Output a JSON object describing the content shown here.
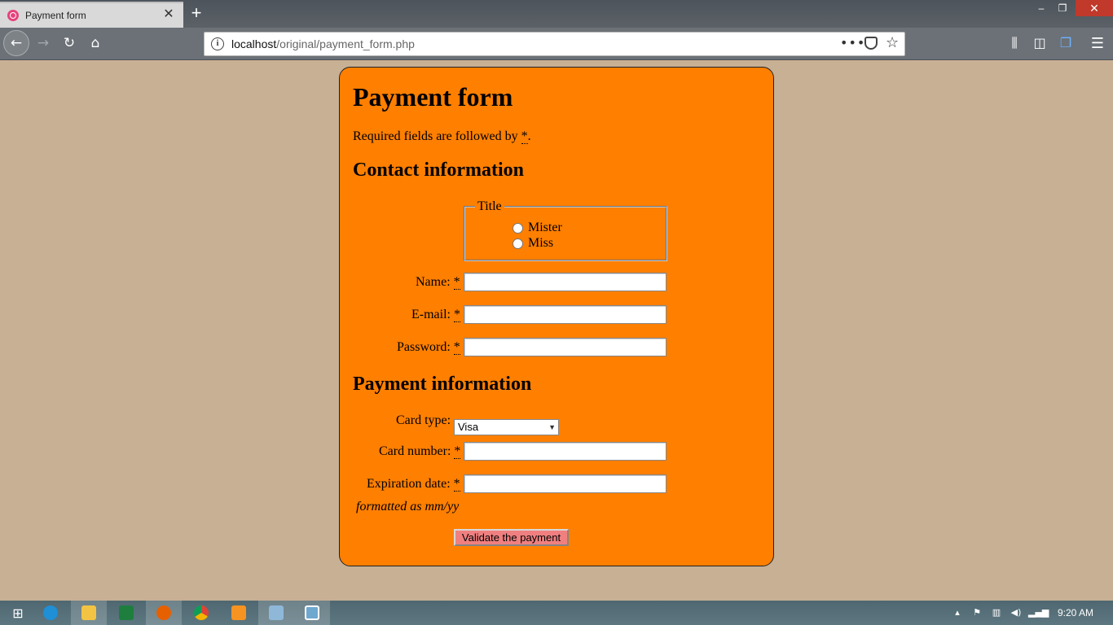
{
  "browser": {
    "tab_title": "Payment form",
    "tab_close": "✕",
    "new_tab": "+",
    "url_host": "localhost",
    "url_path": "/original/payment_form.php",
    "window_controls": {
      "minimize": "–",
      "restore": "❐",
      "close": "✕"
    },
    "icons": [
      "back-arrow-icon",
      "forward-arrow-icon",
      "reload-icon",
      "home-icon",
      "site-info-icon",
      "page-actions-icon",
      "pocket-icon",
      "bookmark-star-icon",
      "library-icon",
      "sidebar-icon",
      "sync-tabs-icon",
      "hamburger-menu-icon"
    ]
  },
  "form": {
    "title": "Payment form",
    "required_note_prefix": "Required fields are followed by ",
    "required_marker": "*",
    "required_note_suffix": ".",
    "contact_heading": "Contact information",
    "title_legend": "Title",
    "title_options": [
      "Mister",
      "Miss"
    ],
    "name_label": "Name: ",
    "email_label": "E-mail: ",
    "password_label": "Password: ",
    "payment_heading": "Payment information",
    "card_type_label": "Card type:",
    "card_type_selected": "Visa",
    "card_number_label": "Card number: ",
    "expiration_label": "Expiration date: ",
    "expiration_hint": "formatted as mm/yy",
    "submit_label": "Validate the payment",
    "values": {
      "name": "",
      "email": "",
      "password": "",
      "card_number": "",
      "expiration": ""
    }
  },
  "colors": {
    "page_background": "#c8b094",
    "form_background": "#ff7f00",
    "button_background": "#f08080"
  },
  "taskbar": {
    "apps": [
      "windows-start-icon",
      "internet-explorer-icon",
      "file-explorer-icon",
      "excel-icon",
      "firefox-icon",
      "chrome-icon",
      "sublime-text-icon",
      "paint-icon",
      "photos-icon"
    ],
    "clock": "9:20 AM"
  }
}
